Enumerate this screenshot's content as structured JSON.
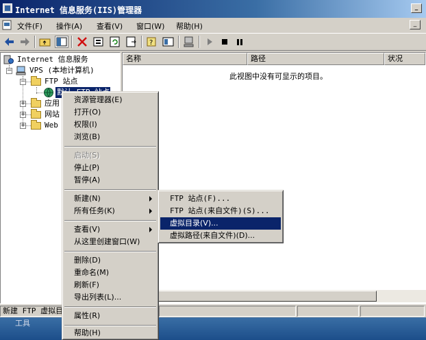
{
  "window": {
    "title": "Internet 信息服务(IIS)管理器"
  },
  "menubar": {
    "items": [
      "文件(F)",
      "操作(A)",
      "查看(V)",
      "窗口(W)",
      "帮助(H)"
    ]
  },
  "toolbar": {
    "buttons": [
      "back",
      "forward",
      "up-folder",
      "show-hide-tree",
      "delete",
      "properties",
      "refresh",
      "export-list",
      "help",
      "console-view",
      "computer",
      "play",
      "stop",
      "pause"
    ]
  },
  "tree": {
    "root": "Internet 信息服务",
    "computer": "VPS (本地计算机)",
    "ftp_sites": "FTP 站点",
    "ftp_child": "默认 FTP 站点",
    "app_pools": "应用",
    "websites": "网站",
    "web_ext": "Web"
  },
  "list": {
    "columns": [
      "名称",
      "路径",
      "状况"
    ],
    "empty_message": "此视图中没有可显示的项目。"
  },
  "statusbar": {
    "text": "新建 FTP 虚拟目"
  },
  "taskbar": {
    "label": "工具"
  },
  "context_menu": {
    "items": [
      {
        "label": "资源管理器(E)",
        "enabled": true
      },
      {
        "label": "打开(O)",
        "enabled": true
      },
      {
        "label": "权限(I)",
        "enabled": true
      },
      {
        "label": "浏览(B)",
        "enabled": true
      },
      {
        "label": "启动(S)",
        "enabled": false
      },
      {
        "label": "停止(P)",
        "enabled": true
      },
      {
        "label": "暂停(A)",
        "enabled": true
      },
      {
        "label": "新建(N)",
        "enabled": true,
        "submenu": true,
        "active": true
      },
      {
        "label": "所有任务(K)",
        "enabled": true,
        "submenu": true
      },
      {
        "label": "查看(V)",
        "enabled": true,
        "submenu": true
      },
      {
        "label": "从这里创建窗口(W)",
        "enabled": true
      },
      {
        "label": "删除(D)",
        "enabled": true
      },
      {
        "label": "重命名(M)",
        "enabled": true
      },
      {
        "label": "刷新(F)",
        "enabled": true
      },
      {
        "label": "导出列表(L)...",
        "enabled": true
      },
      {
        "label": "属性(R)",
        "enabled": true
      },
      {
        "label": "帮助(H)",
        "enabled": true
      }
    ]
  },
  "new_submenu": {
    "items": [
      {
        "label": "FTP 站点(F)...",
        "highlighted": false
      },
      {
        "label": "FTP 站点(来自文件)(S)...",
        "highlighted": false
      },
      {
        "label": "虚拟目录(V)...",
        "highlighted": true
      },
      {
        "label": "虚拟路径(来自文件)(D)...",
        "highlighted": false
      }
    ]
  },
  "colors": {
    "titlebar": "#0a246a",
    "highlight": "#0a246a",
    "face": "#d4d0c8"
  }
}
